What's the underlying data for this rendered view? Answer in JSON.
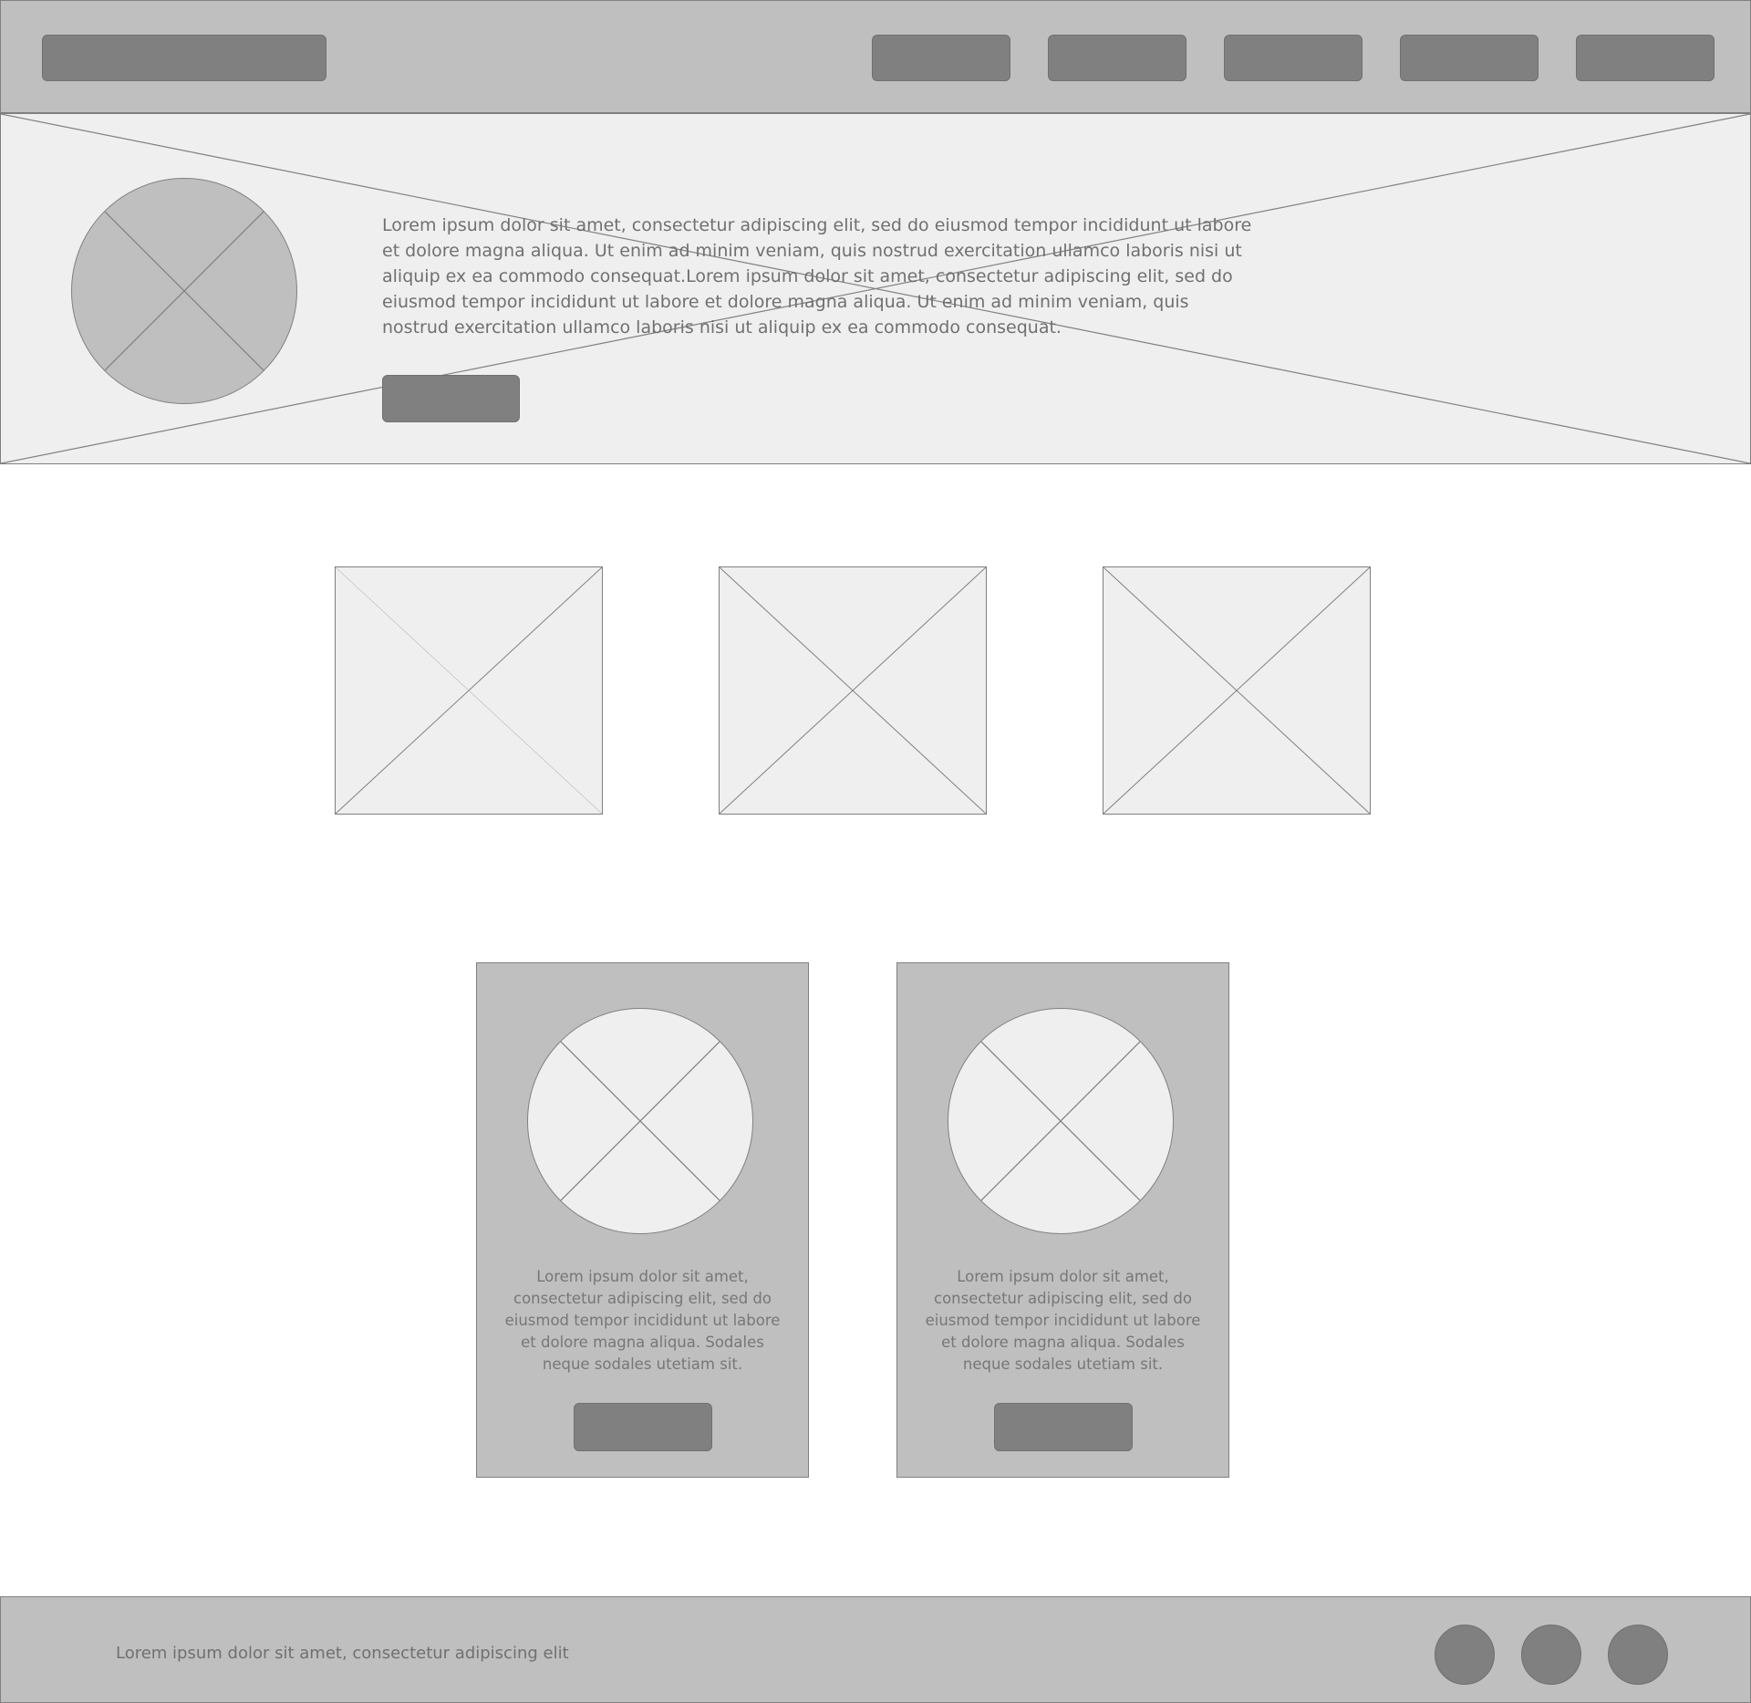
{
  "hero": {
    "text": "Lorem ipsum dolor sit amet, consectetur adipiscing elit, sed do eiusmod tempor incididunt ut labore et dolore magna aliqua. Ut enim ad minim veniam, quis nostrud exercitation ullamco laboris nisi ut aliquip ex ea commodo consequat.Lorem ipsum dolor sit amet, consectetur adipiscing elit, sed do eiusmod tempor incididunt ut labore et dolore magna aliqua. Ut enim ad minim veniam, quis nostrud exercitation ullamco laboris nisi ut aliquip ex ea commodo consequat."
  },
  "cards": [
    {
      "text": "Lorem ipsum dolor sit amet, consectetur adipiscing elit, sed do eiusmod tempor incididunt ut labore et dolore magna aliqua. Sodales neque sodales utetiam sit."
    },
    {
      "text": "Lorem ipsum dolor sit amet, consectetur adipiscing elit, sed do eiusmod tempor incididunt ut labore et dolore magna aliqua. Sodales neque sodales utetiam sit."
    }
  ],
  "footer": {
    "text": "Lorem ipsum dolor sit amet, consectetur adipiscing elit"
  }
}
